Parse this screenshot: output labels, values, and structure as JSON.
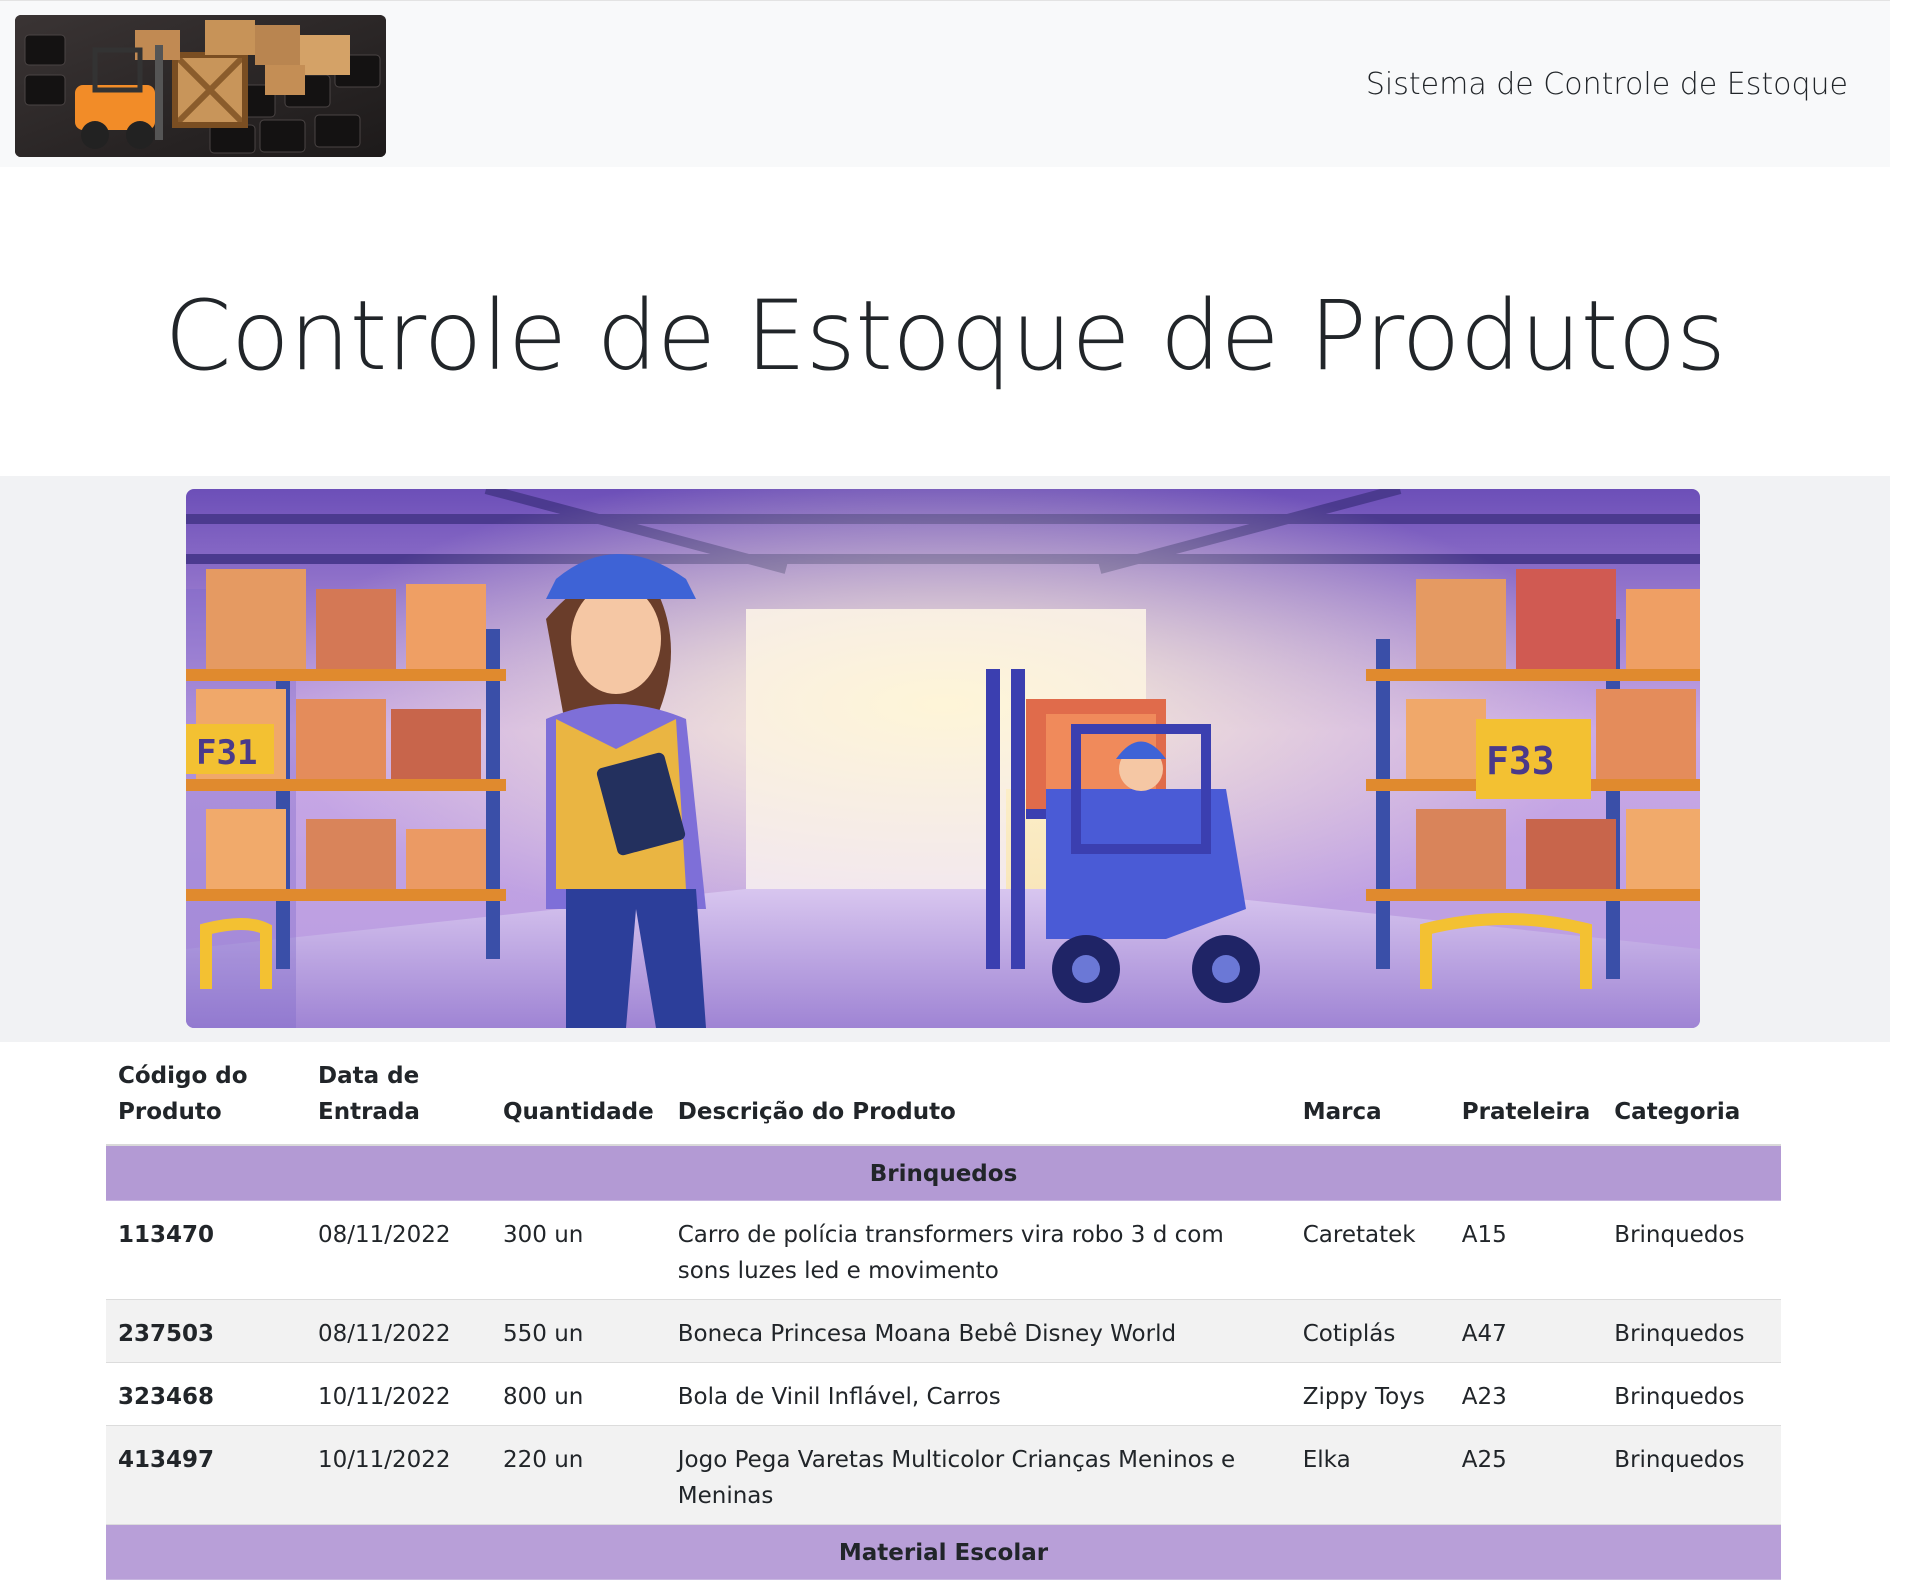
{
  "header": {
    "brand": "Sistema de Controle de Estoque",
    "logo_icon": "warehouse-forklift-logo"
  },
  "page": {
    "title": "Controle de Estoque de Produtos"
  },
  "hero": {
    "icon": "warehouse-illustration",
    "rack_left_label": "F31",
    "rack_right_label": "F33"
  },
  "table": {
    "columns": [
      "Código do Produto",
      "Data de Entrada",
      "Quantidade",
      "Descrição do Produto",
      "Marca",
      "Prateleira",
      "Categoria"
    ],
    "groups": [
      {
        "name": "Brinquedos",
        "rows": [
          {
            "code": "113470",
            "date": "08/11/2022",
            "qty": "300 un",
            "desc": "Carro de polícia transformers vira robo 3 d com sons luzes led e movimento",
            "brand": "Caretatek",
            "shelf": "A15",
            "category": "Brinquedos"
          },
          {
            "code": "237503",
            "date": "08/11/2022",
            "qty": "550 un",
            "desc": "Boneca Princesa Moana Bebê Disney World",
            "brand": "Cotiplás",
            "shelf": "A47",
            "category": "Brinquedos"
          },
          {
            "code": "323468",
            "date": "10/11/2022",
            "qty": "800 un",
            "desc": "Bola de Vinil Inflável, Carros",
            "brand": "Zippy Toys",
            "shelf": "A23",
            "category": "Brinquedos"
          },
          {
            "code": "413497",
            "date": "10/11/2022",
            "qty": "220 un",
            "desc": "Jogo Pega Varetas Multicolor Crianças Meninos e Meninas",
            "brand": "Elka",
            "shelf": "A25",
            "category": "Brinquedos"
          }
        ]
      },
      {
        "name": "Material Escolar",
        "rows": []
      }
    ]
  }
}
